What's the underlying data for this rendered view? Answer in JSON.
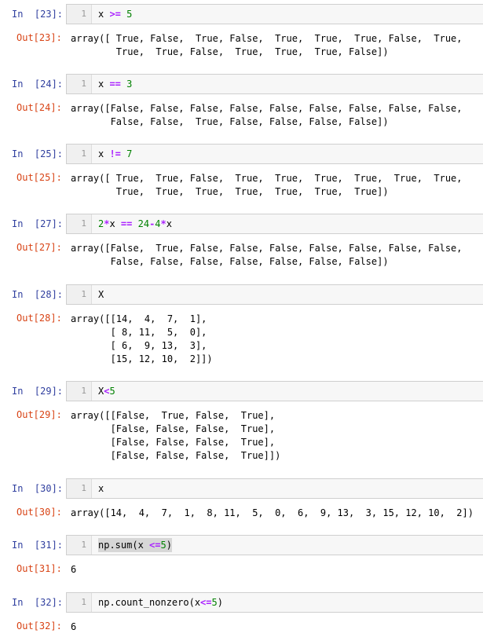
{
  "cells": [
    {
      "in_prompt": "In  [23]:",
      "line_no": "1",
      "code": [
        {
          "t": "x ",
          "c": ""
        },
        {
          "t": ">=",
          "c": "op"
        },
        {
          "t": " 5",
          "c": "num"
        }
      ],
      "out_prompt": "Out[23]:",
      "output": "array([ True, False,  True, False,  True,  True,  True, False,  True,\n        True,  True, False,  True,  True,  True, False])"
    },
    {
      "in_prompt": "In  [24]:",
      "line_no": "1",
      "code": [
        {
          "t": "x ",
          "c": ""
        },
        {
          "t": "==",
          "c": "op"
        },
        {
          "t": " 3",
          "c": "num"
        }
      ],
      "out_prompt": "Out[24]:",
      "output": "array([False, False, False, False, False, False, False, False, False,\n       False, False,  True, False, False, False, False])"
    },
    {
      "in_prompt": "In  [25]:",
      "line_no": "1",
      "code": [
        {
          "t": "x ",
          "c": ""
        },
        {
          "t": "!=",
          "c": "op"
        },
        {
          "t": " 7",
          "c": "num"
        }
      ],
      "out_prompt": "Out[25]:",
      "output": "array([ True,  True, False,  True,  True,  True,  True,  True,  True,\n        True,  True,  True,  True,  True,  True,  True])"
    },
    {
      "in_prompt": "In  [27]:",
      "line_no": "1",
      "code": [
        {
          "t": "2",
          "c": "num"
        },
        {
          "t": "*",
          "c": "op"
        },
        {
          "t": "x ",
          "c": ""
        },
        {
          "t": "==",
          "c": "op"
        },
        {
          "t": " 24",
          "c": "num"
        },
        {
          "t": "-",
          "c": "op"
        },
        {
          "t": "4",
          "c": "num"
        },
        {
          "t": "*",
          "c": "op"
        },
        {
          "t": "x",
          "c": ""
        }
      ],
      "out_prompt": "Out[27]:",
      "output": "array([False,  True, False, False, False, False, False, False, False,\n       False, False, False, False, False, False, False])"
    },
    {
      "in_prompt": "In  [28]:",
      "line_no": "1",
      "code": [
        {
          "t": "X",
          "c": ""
        }
      ],
      "out_prompt": "Out[28]:",
      "output": "array([[14,  4,  7,  1],\n       [ 8, 11,  5,  0],\n       [ 6,  9, 13,  3],\n       [15, 12, 10,  2]])"
    },
    {
      "in_prompt": "In  [29]:",
      "line_no": "1",
      "code": [
        {
          "t": "X",
          "c": ""
        },
        {
          "t": "<",
          "c": "op"
        },
        {
          "t": "5",
          "c": "num"
        }
      ],
      "out_prompt": "Out[29]:",
      "output": "array([[False,  True, False,  True],\n       [False, False, False,  True],\n       [False, False, False,  True],\n       [False, False, False,  True]])"
    },
    {
      "in_prompt": "In  [30]:",
      "line_no": "1",
      "code": [
        {
          "t": "x",
          "c": ""
        }
      ],
      "out_prompt": "Out[30]:",
      "output": "array([14,  4,  7,  1,  8, 11,  5,  0,  6,  9, 13,  3, 15, 12, 10,  2])"
    },
    {
      "in_prompt": "In  [31]:",
      "line_no": "1",
      "code": [
        {
          "t": "np.sum(x ",
          "c": ""
        },
        {
          "t": "<=",
          "c": "op"
        },
        {
          "t": "5",
          "c": "num"
        },
        {
          "t": ")",
          "c": ""
        }
      ],
      "out_prompt": "Out[31]:",
      "output": "6"
    },
    {
      "in_prompt": "In  [32]:",
      "line_no": "1",
      "code": [
        {
          "t": "np.count_nonzero(x",
          "c": ""
        },
        {
          "t": "<=",
          "c": "op"
        },
        {
          "t": "5",
          "c": "num"
        },
        {
          "t": ")",
          "c": ""
        }
      ],
      "out_prompt": "Out[32]:",
      "output": "6"
    }
  ]
}
